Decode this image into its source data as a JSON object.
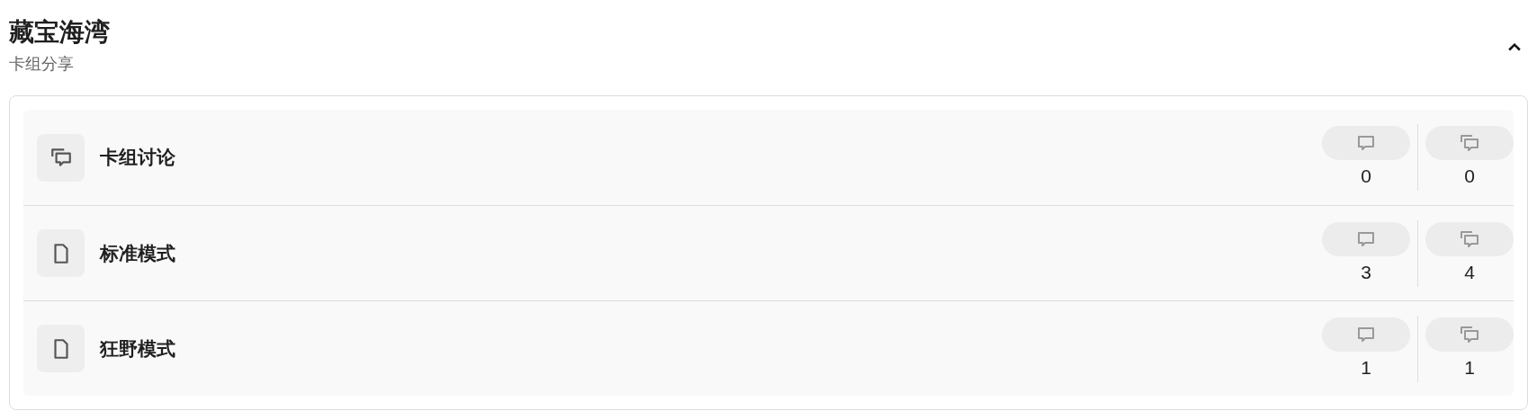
{
  "header": {
    "title": "藏宝海湾",
    "subtitle": "卡组分享",
    "expanded": true
  },
  "forums": [
    {
      "kind": "discussion",
      "name": "卡组讨论",
      "topics": "0",
      "posts": "0"
    },
    {
      "kind": "document",
      "name": "标准模式",
      "topics": "3",
      "posts": "4"
    },
    {
      "kind": "document",
      "name": "狂野模式",
      "topics": "1",
      "posts": "1"
    }
  ]
}
